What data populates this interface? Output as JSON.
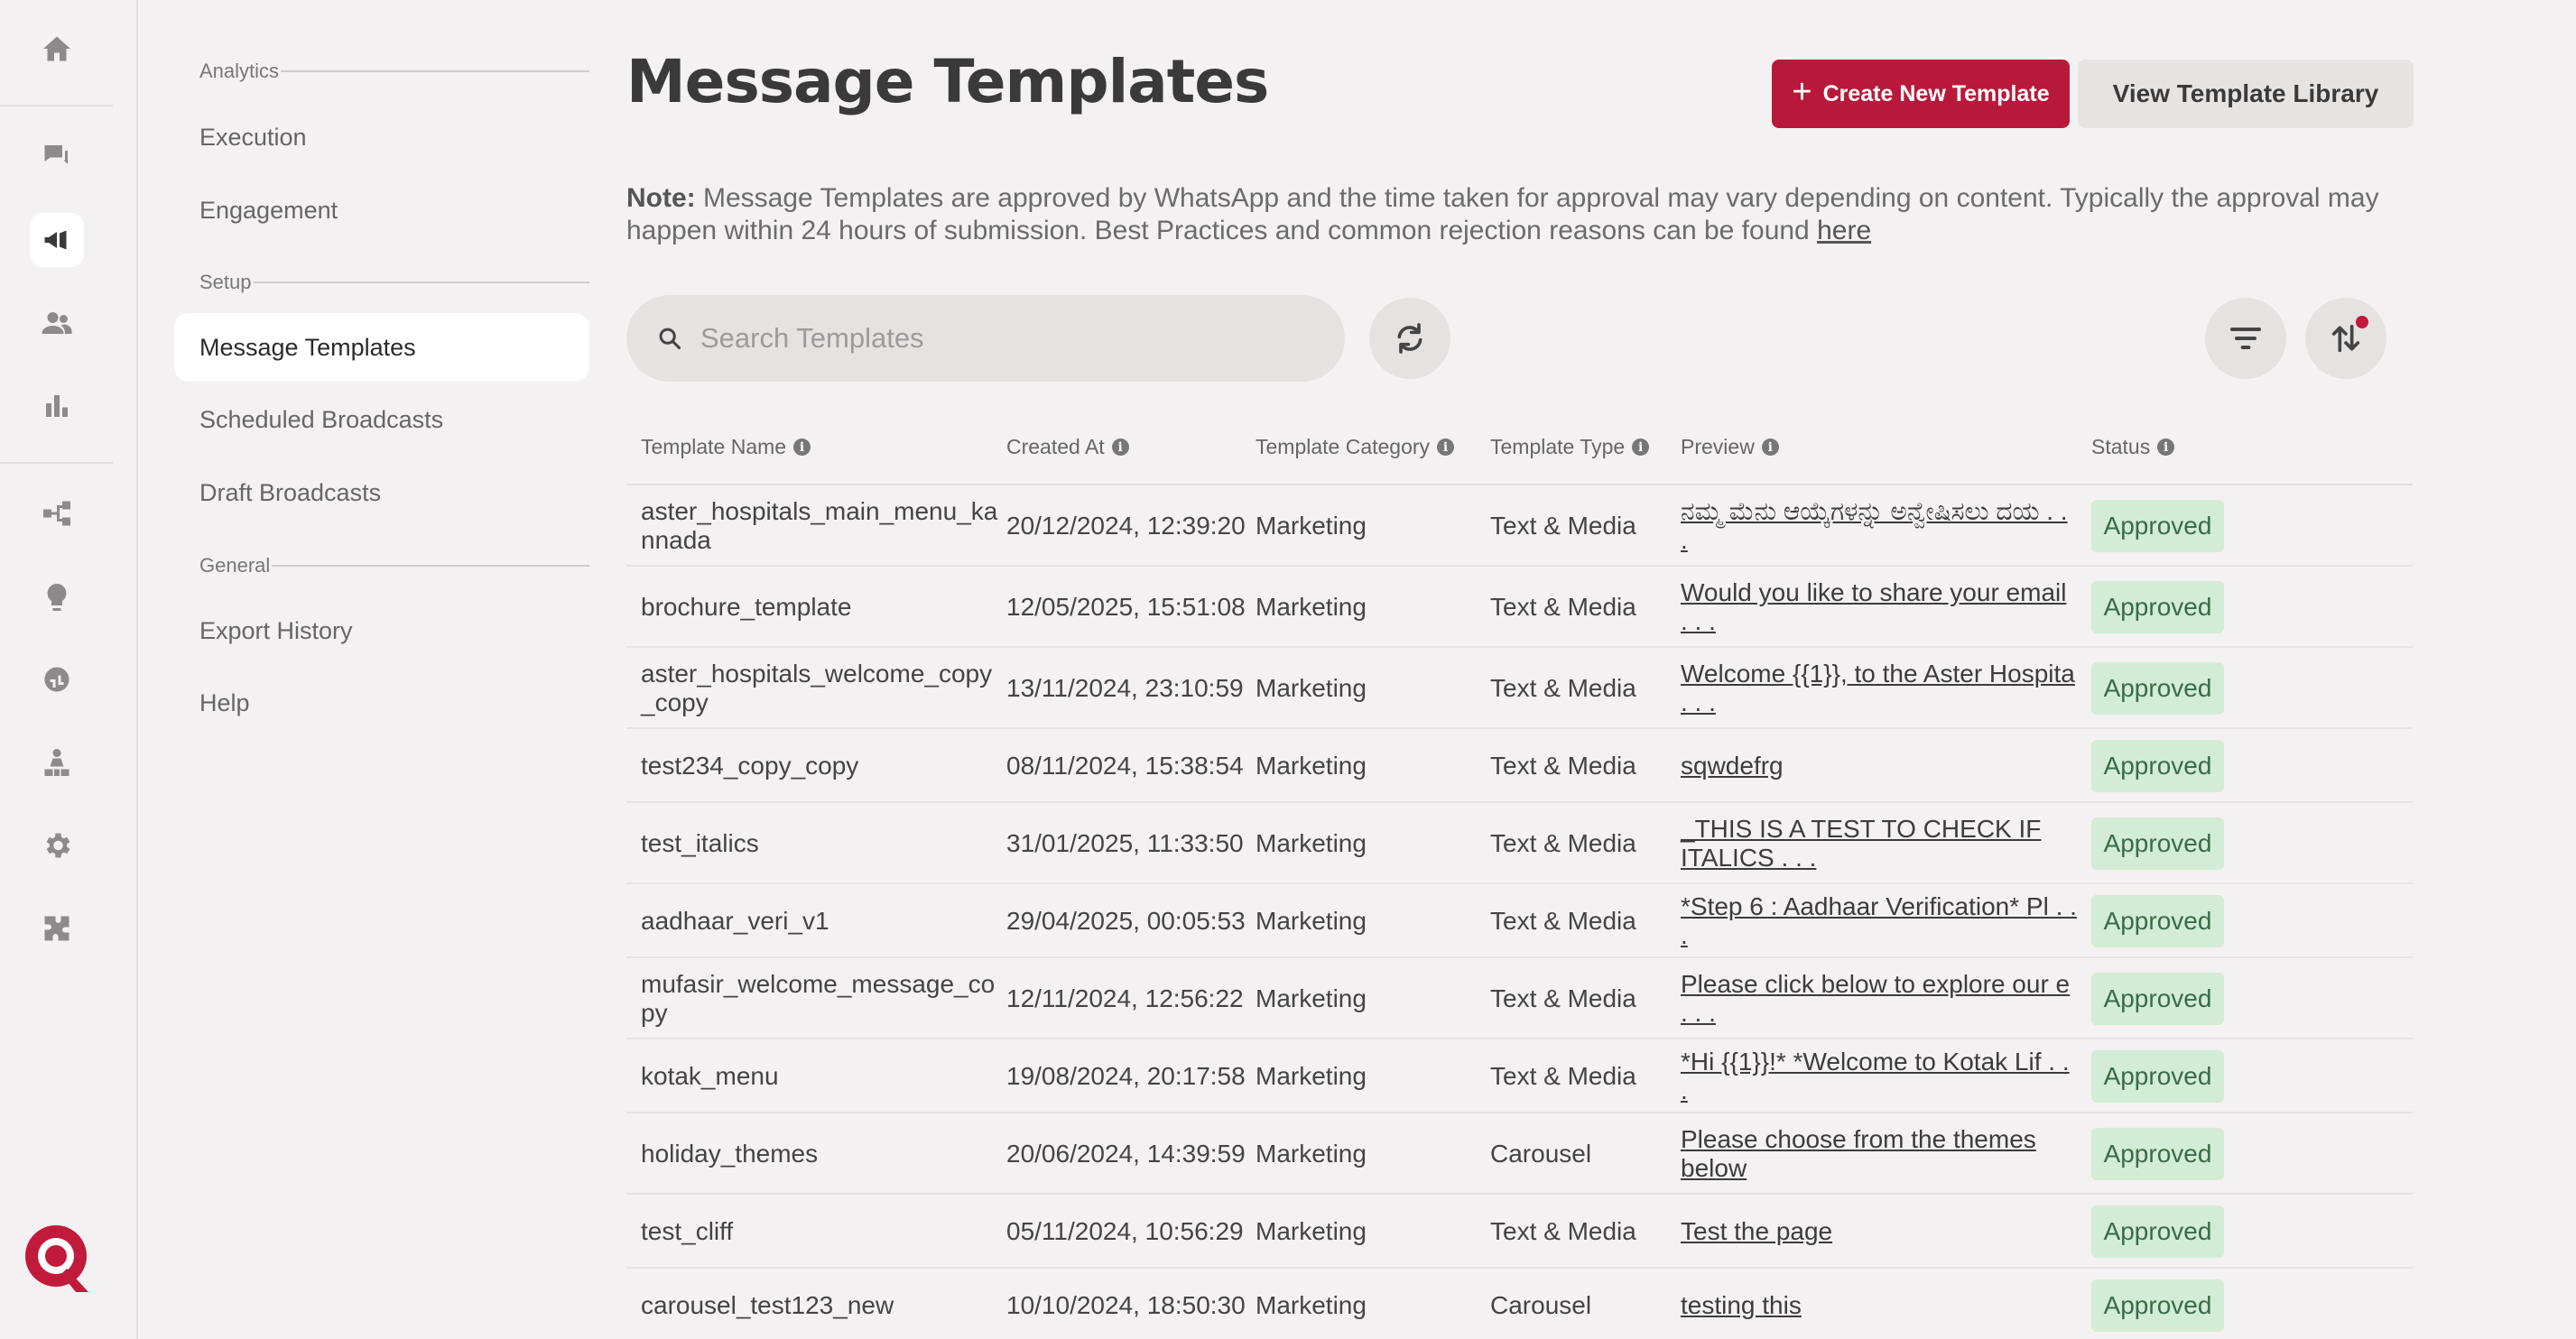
{
  "colors": {
    "accent": "#b8193a",
    "approved_bg": "#d3ecd6",
    "approved_text": "#3a6b46",
    "background": "#f3f1f1"
  },
  "rail": {
    "icons": [
      "home-icon",
      "chat-icon",
      "megaphone-icon",
      "users-icon",
      "bar-chart-icon",
      "flow-icon",
      "lightbulb-icon",
      "brain-icon",
      "hierarchy-icon",
      "gear-icon",
      "puzzle-icon"
    ],
    "active": "megaphone-icon"
  },
  "sidebar": {
    "sections": {
      "analytics": "Analytics",
      "setup": "Setup",
      "general": "General"
    },
    "items": {
      "execution": "Execution",
      "engagement": "Engagement",
      "message_templates": "Message Templates",
      "scheduled_broadcasts": "Scheduled Broadcasts",
      "draft_broadcasts": "Draft Broadcasts",
      "export_history": "Export History",
      "help": "Help"
    },
    "active": "Message Templates"
  },
  "header": {
    "title": "Message Templates",
    "create_button": "Create New Template",
    "library_button": "View Template Library"
  },
  "note": {
    "label": "Note:",
    "text": " Message Templates are approved by WhatsApp and the time taken for approval may vary depending on content. Typically the approval may happen within 24 hours of submission. Best Practices and common rejection reasons can be found ",
    "link": "here"
  },
  "search": {
    "placeholder": "Search Templates",
    "value": ""
  },
  "table": {
    "columns": {
      "name": "Template Name",
      "created": "Created At",
      "category": "Template Category",
      "type": "Template Type",
      "preview": "Preview",
      "status": "Status"
    },
    "rows": [
      {
        "name": "aster_hospitals_main_menu_kannada",
        "created": "20/12/2024, 12:39:20",
        "category": "Marketing",
        "type": "Text & Media",
        "preview": "ನಮ್ಮ ಮೆನು ಆಯ್ಕೆಗಳನ್ನು ಅನ್ವೇಷಿಸಲು ದಯ . . .",
        "status": "Approved"
      },
      {
        "name": "brochure_template",
        "created": "12/05/2025, 15:51:08",
        "category": "Marketing",
        "type": "Text & Media",
        "preview": "Would you like to share your email . . .",
        "status": "Approved"
      },
      {
        "name": "aster_hospitals_welcome_copy_copy",
        "created": "13/11/2024, 23:10:59",
        "category": "Marketing",
        "type": "Text & Media",
        "preview": "Welcome {{1}}, to the Aster Hospita . . .",
        "status": "Approved"
      },
      {
        "name": "test234_copy_copy",
        "created": "08/11/2024, 15:38:54",
        "category": "Marketing",
        "type": "Text & Media",
        "preview": "sqwdefrg",
        "status": "Approved"
      },
      {
        "name": "test_italics",
        "created": "31/01/2025, 11:33:50",
        "category": "Marketing",
        "type": "Text & Media",
        "preview": "_THIS IS A TEST TO CHECK IF ITALICS . . .",
        "status": "Approved"
      },
      {
        "name": "aadhaar_veri_v1",
        "created": "29/04/2025, 00:05:53",
        "category": "Marketing",
        "type": "Text & Media",
        "preview": "*Step 6 : Aadhaar Verification* Pl . . .",
        "status": "Approved"
      },
      {
        "name": "mufasir_welcome_message_copy",
        "created": "12/11/2024, 12:56:22",
        "category": "Marketing",
        "type": "Text & Media",
        "preview": "Please click below to explore our e . . .",
        "status": "Approved"
      },
      {
        "name": "kotak_menu",
        "created": "19/08/2024, 20:17:58",
        "category": "Marketing",
        "type": "Text & Media",
        "preview": "*Hi {{1}}!* *Welcome to Kotak Lif . . .",
        "status": "Approved"
      },
      {
        "name": "holiday_themes",
        "created": "20/06/2024, 14:39:59",
        "category": "Marketing",
        "type": "Carousel",
        "preview": "Please choose from the themes below",
        "status": "Approved"
      },
      {
        "name": "test_cliff",
        "created": "05/11/2024, 10:56:29",
        "category": "Marketing",
        "type": "Text & Media",
        "preview": "Test the page",
        "status": "Approved"
      },
      {
        "name": "carousel_test123_new",
        "created": "10/10/2024, 18:50:30",
        "category": "Marketing",
        "type": "Carousel",
        "preview": "testing this",
        "status": "Approved"
      }
    ]
  }
}
